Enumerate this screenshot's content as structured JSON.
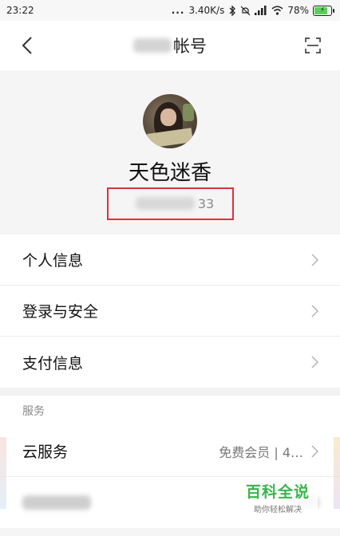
{
  "status_bar": {
    "time": "23:22",
    "dots": "...",
    "network_speed": "3.40K/s",
    "battery_percent": "78%",
    "icons": [
      "bluetooth-icon",
      "mute-icon",
      "signal-icon",
      "wifi-icon",
      "battery-charging-icon"
    ]
  },
  "header": {
    "title_suffix": "帐号",
    "back_icon": "back-arrow-icon",
    "scan_icon": "scan-icon"
  },
  "profile": {
    "nickname": "天色迷香",
    "account_tail": "33",
    "highlight_color": "#d9333a"
  },
  "menu": {
    "items": [
      {
        "label": "个人信息"
      },
      {
        "label": "登录与安全"
      },
      {
        "label": "支付信息"
      }
    ]
  },
  "services": {
    "section_title": "服务",
    "cloud_label": "云服务",
    "cloud_value": "免费会员 | 4…"
  },
  "watermark": {
    "title": "百科全说",
    "subtitle": "助你轻松解决",
    "color": "#38b54a"
  }
}
